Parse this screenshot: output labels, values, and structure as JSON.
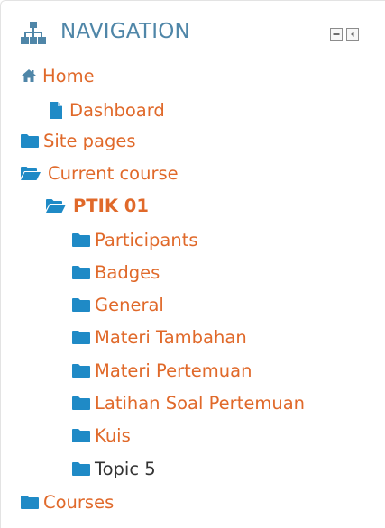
{
  "header": {
    "title": "NAVIGATION"
  },
  "nav": {
    "home": "Home",
    "dashboard": "Dashboard",
    "site_pages": "Site pages",
    "current_course": "Current course",
    "course": "PTIK 01",
    "sections": [
      "Participants",
      "Badges",
      "General",
      "Materi Tambahan",
      "Materi Pertemuan",
      "Latihan Soal Pertemuan",
      "Kuis",
      "Topic 5"
    ],
    "courses": "Courses"
  },
  "colors": {
    "link": "#e0692a",
    "icon": "#1f8ac6",
    "header_text": "#4f86a8",
    "plain_text": "#333333"
  },
  "icons": {
    "header": "sitemap-icon",
    "home": "home-icon",
    "dashboard": "file-icon",
    "closed": "folder-icon",
    "open": "folder-open-icon",
    "dock": "dock-icon",
    "collapse": "collapse-icon"
  }
}
